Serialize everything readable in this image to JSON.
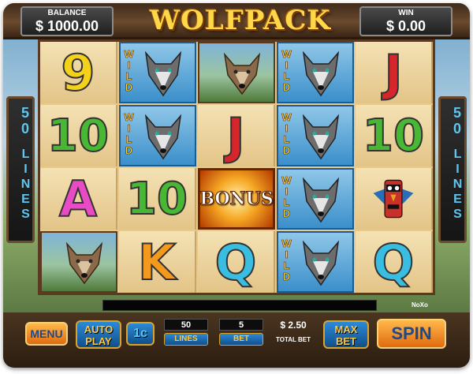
{
  "header": {
    "balance_label": "BALANCE",
    "balance_value": "$ 1000.00",
    "logo_text": "WOLFPACK",
    "win_label": "WIN",
    "win_value": "$ 0.00"
  },
  "side_panels": {
    "lines_count": "50",
    "lines_word": "LINES"
  },
  "reels": {
    "columns": [
      [
        "9",
        "10",
        "A",
        "wolf-scene"
      ],
      [
        "WILD",
        "WILD",
        "10",
        "K"
      ],
      [
        "wolf-scene",
        "J",
        "BONUS",
        "Q"
      ],
      [
        "WILD",
        "WILD",
        "WILD",
        "WILD"
      ],
      [
        "J",
        "10",
        "totem",
        "Q"
      ]
    ],
    "wild_text": "WILD",
    "bonus_text": "BONUS"
  },
  "status": {
    "noxo": "NoXo"
  },
  "controls": {
    "menu_label": "MENU",
    "autoplay_label": "AUTO PLAY",
    "coin_label": "1c",
    "lines_value": "50",
    "lines_label": "LINES",
    "bet_value": "5",
    "bet_label": "BET",
    "total_bet_value": "$ 2.50",
    "total_bet_label": "TOTAL BET",
    "max_bet_label": "MAX BET",
    "spin_label": "SPIN"
  },
  "colors": {
    "sym_9": "#f4d21c",
    "sym_10": "#48b834",
    "sym_A": "#e84bc3",
    "sym_K": "#f39a1e",
    "sym_Q": "#39bde0",
    "sym_J": "#d6262b",
    "lines_text": "#5ec7f0",
    "button_text": "#f9c84a"
  }
}
